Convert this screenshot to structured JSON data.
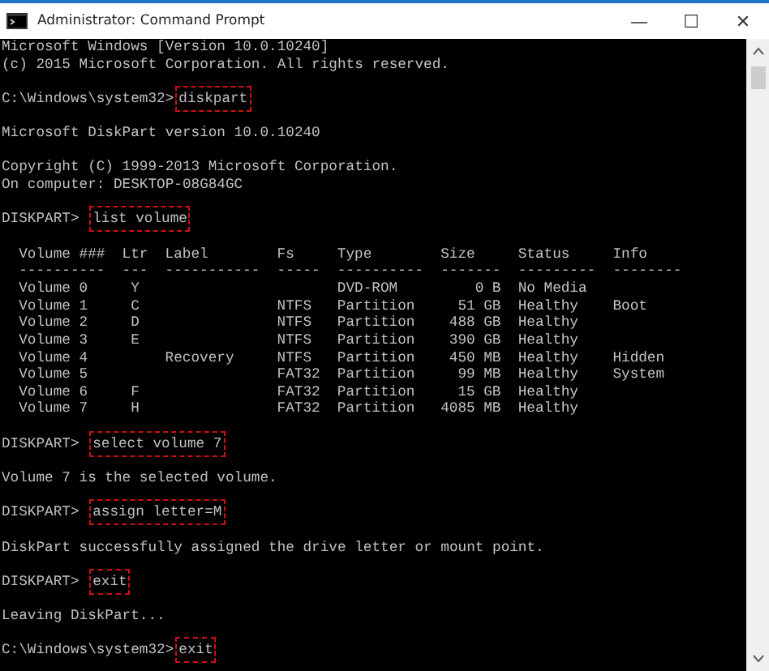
{
  "window": {
    "title": "Administrator: Command Prompt",
    "controls": [
      "—",
      "☐",
      "✕"
    ]
  },
  "lines": [
    {
      "kind": "text",
      "text": "Microsoft Windows [Version 10.0.10240]"
    },
    {
      "kind": "text",
      "text": "(c) 2015 Microsoft Corporation. All rights reserved."
    },
    {
      "kind": "blank"
    },
    {
      "kind": "command",
      "prompt": "C:\\Windows\\system32>",
      "command": "diskpart",
      "highlighted": true
    },
    {
      "kind": "blank"
    },
    {
      "kind": "text",
      "text": "Microsoft DiskPart version 10.0.10240"
    },
    {
      "kind": "blank"
    },
    {
      "kind": "text",
      "text": "Copyright (C) 1999-2013 Microsoft Corporation."
    },
    {
      "kind": "text",
      "text": "On computer: DESKTOP-08G84GC"
    },
    {
      "kind": "blank"
    },
    {
      "kind": "command",
      "prompt": "DISKPART> ",
      "command": "list volume",
      "highlighted": true
    },
    {
      "kind": "blank"
    },
    {
      "kind": "table",
      "columns": [
        "Volume ###",
        "Ltr",
        "Label",
        "Fs",
        "Type",
        "Size",
        "Status",
        "Info"
      ],
      "separators": [
        "----------",
        "---",
        "-----------",
        "-----",
        "----------",
        "-------",
        "---------",
        "--------"
      ],
      "rows": [
        [
          "Volume 0",
          "Y",
          "",
          "",
          "DVD-ROM",
          "0 B",
          "No Media",
          ""
        ],
        [
          "Volume 1",
          "C",
          "",
          "NTFS",
          "Partition",
          "51 GB",
          "Healthy",
          "Boot"
        ],
        [
          "Volume 2",
          "D",
          "",
          "NTFS",
          "Partition",
          "488 GB",
          "Healthy",
          ""
        ],
        [
          "Volume 3",
          "E",
          "",
          "NTFS",
          "Partition",
          "390 GB",
          "Healthy",
          ""
        ],
        [
          "Volume 4",
          "",
          "Recovery",
          "NTFS",
          "Partition",
          "450 MB",
          "Healthy",
          "Hidden"
        ],
        [
          "Volume 5",
          "",
          "",
          "FAT32",
          "Partition",
          "99 MB",
          "Healthy",
          "System"
        ],
        [
          "Volume 6",
          "F",
          "",
          "FAT32",
          "Partition",
          "15 GB",
          "Healthy",
          ""
        ],
        [
          "Volume 7",
          "H",
          "",
          "FAT32",
          "Partition",
          "4085 MB",
          "Healthy",
          ""
        ]
      ]
    },
    {
      "kind": "blank"
    },
    {
      "kind": "command",
      "prompt": "DISKPART> ",
      "command": "select volume 7",
      "highlighted": true
    },
    {
      "kind": "blank"
    },
    {
      "kind": "text",
      "text": "Volume 7 is the selected volume."
    },
    {
      "kind": "blank"
    },
    {
      "kind": "command",
      "prompt": "DISKPART> ",
      "command": "assign letter=M",
      "highlighted": true
    },
    {
      "kind": "blank"
    },
    {
      "kind": "text",
      "text": "DiskPart successfully assigned the drive letter or mount point."
    },
    {
      "kind": "blank"
    },
    {
      "kind": "command",
      "prompt": "DISKPART> ",
      "command": "exit",
      "highlighted": true
    },
    {
      "kind": "blank"
    },
    {
      "kind": "text",
      "text": "Leaving DiskPart..."
    },
    {
      "kind": "blank"
    },
    {
      "kind": "command",
      "prompt": "C:\\Windows\\system32>",
      "command": "exit",
      "highlighted": true
    }
  ]
}
